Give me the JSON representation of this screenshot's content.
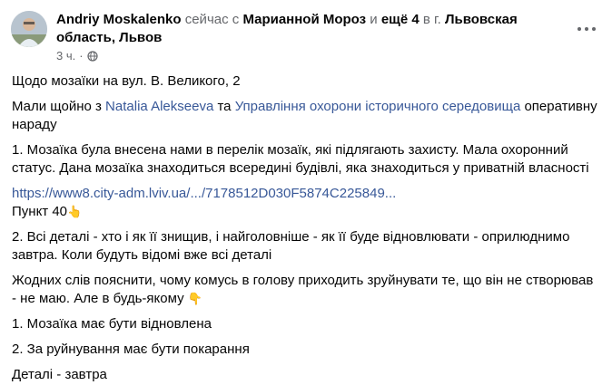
{
  "post": {
    "author": "Andriy Moskalenko",
    "time_phrase": "сейчас с",
    "tagged_person": "Марианной Мороз",
    "and_word": "и",
    "others": "ещё 4",
    "location_prefix": "в г.",
    "location": "Львовская область, Львов",
    "timestamp": "3 ч.",
    "dot": "·",
    "icons": {
      "privacy": "globe-icon",
      "more": "more-dots-icon"
    }
  },
  "content": {
    "p1": "Щодо мозаїки на вул. В. Великого, 2",
    "p2_before": "Мали щойно з ",
    "p2_link1": "Natalia Alekseeva",
    "p2_middle": " та ",
    "p2_link2": "Управління охорони історичного середовища",
    "p2_after": " оперативну нараду",
    "p3": "1. Мозаїка була внесена нами в перелік мозаїк, які підлягають захисту. Мала охоронний статус. Дана мозаїка знаходиться всередині будівлі, яка знаходиться у приватній власності",
    "url": "https://www8.city-adm.lviv.ua/.../7178512D030F5874C225849...",
    "p4": "Пункт 40",
    "p5": "2. Всі деталі - хто і як її знищив, і найголовніше - як її буде відновлювати - оприлюднимо завтра. Коли будуть відомі вже всі деталі",
    "p6": "Жодних слів пояснити, чому комусь в голову приходить  зруйнувати те, що він не створював - не маю. Але в будь-якому",
    "p7": "1. Мозаїка має бути відновлена",
    "p8": "2. За руйнування має бути покарання",
    "p9": "Деталі - завтра",
    "emoji_up": "👆",
    "emoji_down": "👇"
  },
  "colors": {
    "link": "#385898",
    "muted": "#65676b",
    "text": "#050505"
  }
}
